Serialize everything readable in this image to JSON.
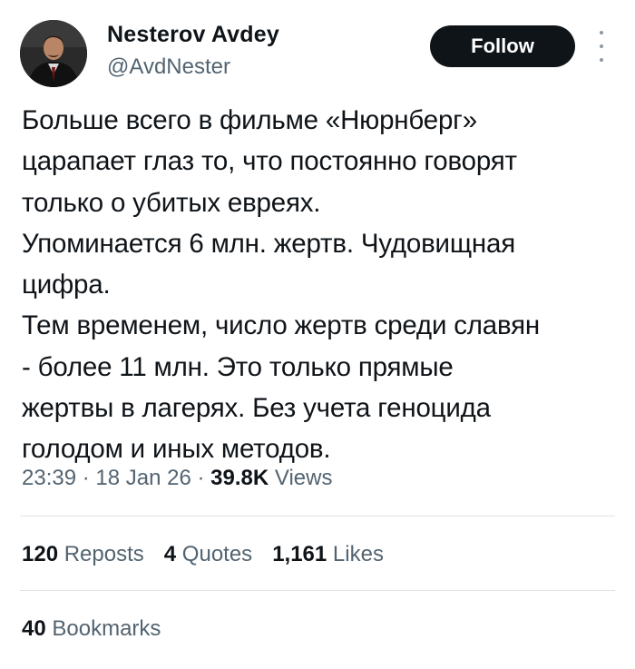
{
  "author": {
    "name": "Nesterov Avdey",
    "handle": "@AvdNester"
  },
  "actions": {
    "follow_label": "Follow",
    "more_icon": "more-vertical-icon"
  },
  "tweet": {
    "lines": [
      "Больше всего в фильме «Нюрнберг»",
      "царапает глаз то, что постоянно говорят",
      "только о убитых евреях.",
      "Упоминается 6 млн. жертв. Чудовищная",
      "цифра.",
      "Тем временем, число жертв среди славян",
      "- более 11 млн. Это только прямые",
      "жертвы в лагерях. Без учета геноцида",
      "голодом и иных методов."
    ]
  },
  "meta": {
    "time": "23:39",
    "separator": "·",
    "date": "18 Jan 26",
    "views_count": "39.8K",
    "views_label": "Views"
  },
  "stats": {
    "reposts": {
      "count": "120",
      "label": "Reposts"
    },
    "quotes": {
      "count": "4",
      "label": "Quotes"
    },
    "likes": {
      "count": "1,161",
      "label": "Likes"
    },
    "bookmarks": {
      "count": "40",
      "label": "Bookmarks"
    }
  },
  "colors": {
    "text_primary": "#0f1419",
    "text_secondary": "#536471",
    "button_bg": "#0f1419",
    "divider": "#dfe3e6"
  }
}
